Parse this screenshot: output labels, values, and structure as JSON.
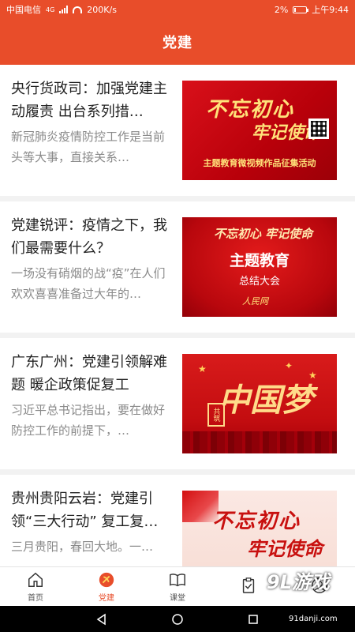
{
  "status_bar": {
    "carrier": "中国电信",
    "network": "4G",
    "speed": "200K/s",
    "battery": "2%",
    "time": "上午9:44"
  },
  "header": {
    "title": "党建"
  },
  "articles": [
    {
      "title": "央行货政司：加强党建主动履责 出台系列措…",
      "summary": "新冠肺炎疫情防控工作是当前头等大事，直接关系…",
      "image": {
        "slogan_line1": "不忘初心",
        "slogan_line2": "牢记使命",
        "banner": "主题教育微视频作品征集活动"
      }
    },
    {
      "title": "党建锐评：疫情之下，我们最需要什么？",
      "summary": "一场没有硝烟的战“疫”在人们欢欢喜喜准备过大年的…",
      "image": {
        "slogan": "不忘初心 牢记使命",
        "title": "主题教育",
        "subtitle": "总结大会",
        "logo": "人民网"
      }
    },
    {
      "title": "广东广州：党建引领解难题 暖企政策促复工",
      "summary": "习近平总书记指出，要在做好防控工作的前提下，…",
      "image": {
        "headline": "中国梦",
        "stamp": "共筑"
      }
    },
    {
      "title": "贵州贵阳云岩：党建引领“三大行动” 复工复…",
      "summary": "三月贵阳，春回大地。一…",
      "image": {
        "slogan_line1": "不忘初心",
        "slogan_line2": "牢记使命"
      }
    }
  ],
  "tabbar": {
    "items": [
      {
        "label": "首页",
        "icon": "home-icon"
      },
      {
        "label": "党建",
        "icon": "party-emblem-icon",
        "active": true
      },
      {
        "label": "课堂",
        "icon": "book-icon"
      },
      {
        "label": "",
        "icon": "clipboard-icon"
      },
      {
        "label": "",
        "icon": "user-icon"
      }
    ]
  },
  "watermark": {
    "logo": "9L游戏",
    "url": "91danji.com"
  },
  "colors": {
    "accent": "#e84d2a",
    "title_text": "#222222",
    "summary_text": "#8a8a8a"
  }
}
